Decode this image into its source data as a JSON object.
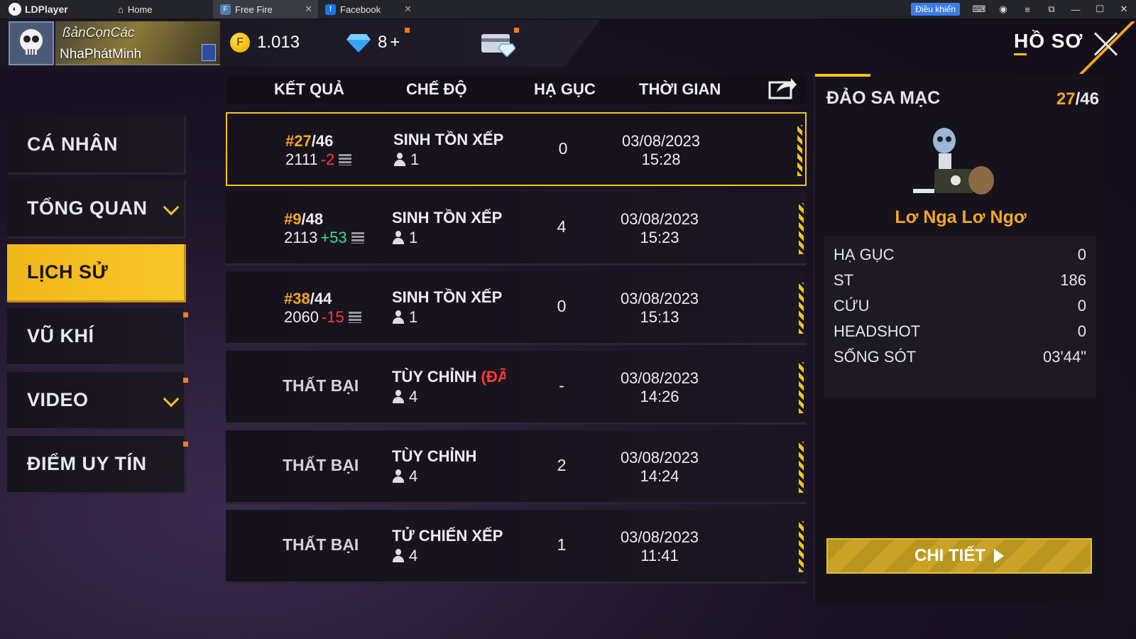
{
  "titlebar": {
    "app_name": "LDPlayer",
    "tabs": [
      {
        "label": "Home"
      },
      {
        "label": "Free Fire"
      },
      {
        "label": "Facebook"
      }
    ],
    "control_label": "Điều khiển"
  },
  "header": {
    "clan_name": "ßảnCọnCác",
    "player_name": "NhaPhátMinh",
    "gold": "1.013",
    "diamonds": "8",
    "diamonds_plus": "+",
    "title": "HỒ SƠ"
  },
  "sidebar": {
    "items": [
      {
        "label": "CÁ NHÂN",
        "active": false,
        "chevron": false,
        "dot": false
      },
      {
        "label": "TỔNG QUAN",
        "active": false,
        "chevron": true,
        "dot": false
      },
      {
        "label": "LỊCH SỬ",
        "active": true,
        "chevron": false,
        "dot": false
      },
      {
        "label": "VŨ KHÍ",
        "active": false,
        "chevron": false,
        "dot": true
      },
      {
        "label": "VIDEO",
        "active": false,
        "chevron": true,
        "dot": true
      },
      {
        "label": "ĐIỂM UY TÍN",
        "active": false,
        "chevron": false,
        "dot": true
      }
    ]
  },
  "table": {
    "headers": {
      "result": "KẾT QUẢ",
      "mode": "CHẾ ĐỘ",
      "kills": "HẠ GỤC",
      "time": "THỜI GIAN"
    },
    "rows": [
      {
        "rank": "#27",
        "of": "/46",
        "points": "2111",
        "delta": "-2",
        "delta_type": "neg",
        "mode": "SINH TỒN XẾP HẠ",
        "mode_extra": "",
        "players": "1",
        "kills": "0",
        "date": "03/08/2023",
        "time": "15:28",
        "selected": true
      },
      {
        "rank": "#9",
        "of": "/48",
        "points": "2113",
        "delta": "+53",
        "delta_type": "pos",
        "mode": "SINH TỒN XẾP HẠ",
        "mode_extra": "",
        "players": "1",
        "kills": "4",
        "date": "03/08/2023",
        "time": "15:23",
        "selected": false
      },
      {
        "rank": "#38",
        "of": "/44",
        "points": "2060",
        "delta": "-15",
        "delta_type": "neg",
        "mode": "SINH TỒN XẾP HẠ",
        "mode_extra": "",
        "players": "1",
        "kills": "0",
        "date": "03/08/2023",
        "time": "15:13",
        "selected": false
      },
      {
        "loss": "THẤT BẠI",
        "mode": "TÙY CHỈNH ",
        "mode_extra": "(ĐÃ TI",
        "players": "4",
        "kills": "-",
        "date": "03/08/2023",
        "time": "14:26",
        "selected": false
      },
      {
        "loss": "THẤT BẠI",
        "mode": "TÙY CHỈNH",
        "mode_extra": "",
        "players": "4",
        "kills": "2",
        "date": "03/08/2023",
        "time": "14:24",
        "selected": false
      },
      {
        "loss": "THẤT BẠI",
        "mode": "TỬ CHIẾN XẾP HẠ",
        "mode_extra": "",
        "players": "4",
        "kills": "1",
        "date": "03/08/2023",
        "time": "11:41",
        "selected": false
      }
    ]
  },
  "detail": {
    "map": "ĐẢO SA MẠC",
    "rank": "27",
    "of": "/46",
    "name": "Lơ Nga Lơ Ngơ",
    "stats": [
      {
        "label": "HẠ GỤC",
        "value": "0"
      },
      {
        "label": "ST",
        "value": "186"
      },
      {
        "label": "CỨU",
        "value": "0"
      },
      {
        "label": "HEADSHOT",
        "value": "0"
      },
      {
        "label": "SỐNG SÓT",
        "value": "03'44\""
      }
    ],
    "button_label": "CHI TIẾT"
  },
  "colors": {
    "accent": "#f6c21c",
    "rank_orange": "#f5a623",
    "negative": "#ff3b30",
    "positive": "#35e0a0"
  }
}
